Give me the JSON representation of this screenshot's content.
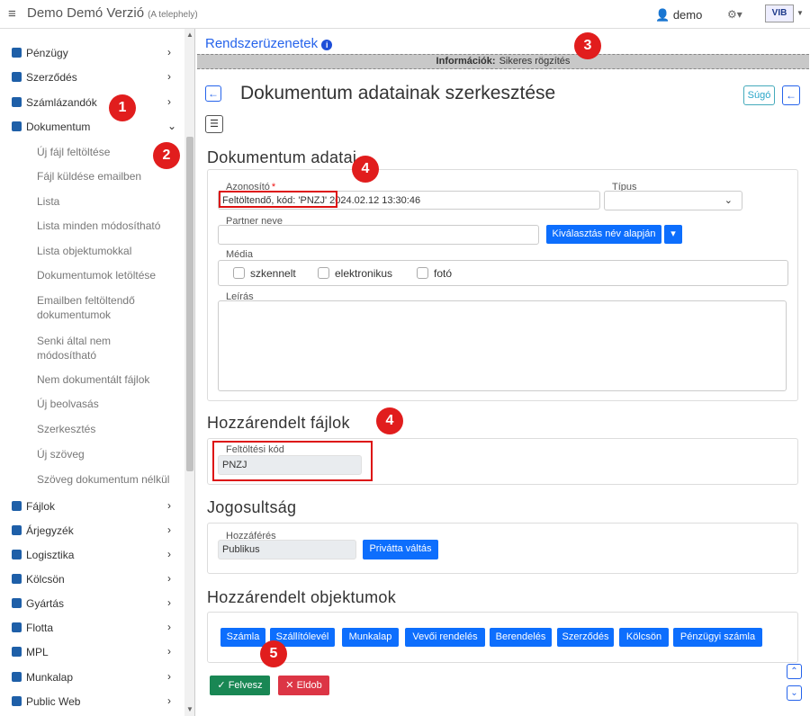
{
  "topbar": {
    "menu_icon": "hamburger-icon",
    "title": "Demo Demó Verzió",
    "subtitle": "(A telephely)",
    "user": "demo",
    "user_icon": "user-icon",
    "gear_icon": "gear-icon",
    "logo": "VIB"
  },
  "sidebar": {
    "items": [
      {
        "label": "Pénzügy",
        "icon": "money-icon",
        "color": "#1e5fa8"
      },
      {
        "label": "Szerződés",
        "icon": "contract-icon",
        "color": "#1e5fa8"
      },
      {
        "label": "Számlázandók",
        "icon": "invoice-icon",
        "color": "#1e5fa8"
      },
      {
        "label": "Dokumentum",
        "icon": "document-icon",
        "color": "#1e5fa8"
      }
    ],
    "subitems": [
      "Új fájl feltöltése",
      "Fájl küldése emailben",
      "Lista",
      "Lista minden módosítható",
      "Lista objektumokkal",
      "Dokumentumok letöltése",
      "Emailben feltöltendő dokumentumok",
      "Senki által nem módosítható",
      "Nem dokumentált fájlok",
      "Új beolvasás",
      "Szerkesztés",
      "Új szöveg",
      "Szöveg dokumentum nélkül"
    ],
    "bottom_items": [
      {
        "label": "Fájlok",
        "icon": "file-icon"
      },
      {
        "label": "Árjegyzék",
        "icon": "tag-icon"
      },
      {
        "label": "Logisztika",
        "icon": "truck-icon"
      },
      {
        "label": "Kölcsön",
        "icon": "hand-icon"
      },
      {
        "label": "Gyártás",
        "icon": "cogs-icon"
      },
      {
        "label": "Flotta",
        "icon": "car-icon"
      },
      {
        "label": "MPL",
        "icon": "delivery-icon"
      },
      {
        "label": "Munkalap",
        "icon": "sheet-icon"
      },
      {
        "label": "Public Web",
        "icon": "web-icon"
      }
    ]
  },
  "main": {
    "system_messages": "Rendszerüzenetek",
    "info_label": "Információk:",
    "info_text": "Sikeres rögzítés",
    "page_title": "Dokumentum adatainak szerkesztése",
    "help": "Súgó",
    "sections": {
      "doc": "Dokumentum adatai",
      "files": "Hozzárendelt fájlok",
      "rights": "Jogosultság",
      "objects": "Hozzárendelt objektumok"
    },
    "fields": {
      "azonosito_label": "Azonosító",
      "azonosito_value": "Feltöltendő, kód: 'PNZJ' 2024.02.12 13:30:46",
      "tipus_label": "Típus",
      "partner_label": "Partner neve",
      "select_btn": "Kiválasztás név alapján",
      "media_label": "Média",
      "media_options": [
        "szkennelt",
        "elektronikus",
        "fotó"
      ],
      "leiras_label": "Leírás",
      "upload_code_label": "Feltöltési kód",
      "upload_code_value": "PNZJ",
      "access_label": "Hozzáférés",
      "access_value": "Publikus",
      "private_btn": "Privátta váltás"
    },
    "object_buttons": [
      "Számla",
      "Szállítólevél",
      "Munkalap",
      "Vevői rendelés",
      "Berendelés",
      "Szerződés",
      "Kölcsön",
      "Pénzügyi számla"
    ],
    "save_btn": "Felvesz",
    "discard_btn": "Eldob"
  },
  "annotations": [
    "1",
    "2",
    "3",
    "4",
    "4",
    "5"
  ]
}
